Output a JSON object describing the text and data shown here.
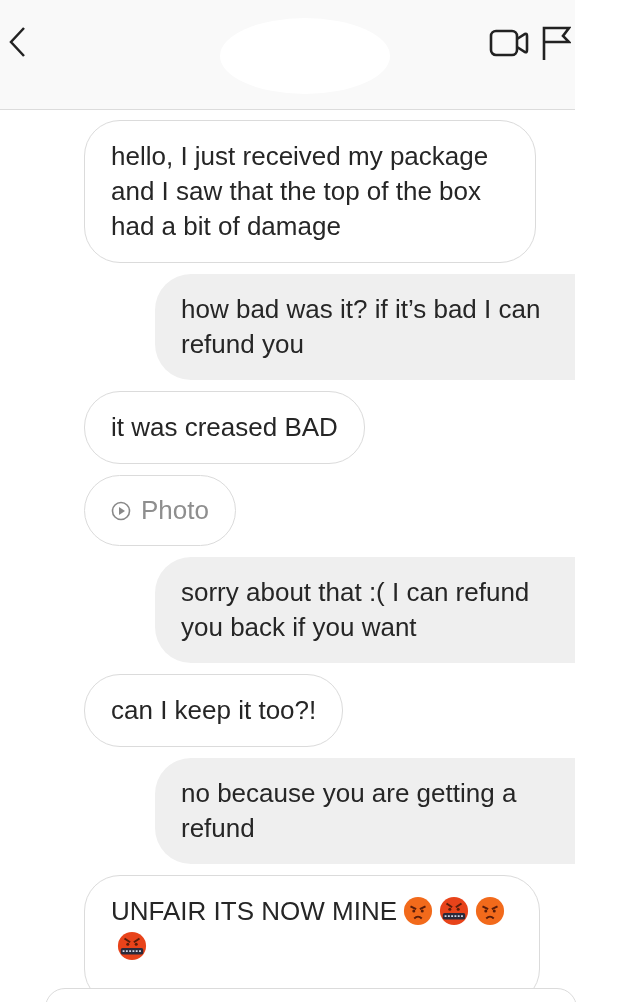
{
  "header": {
    "actions": [
      {
        "kind": "video"
      },
      {
        "kind": "flag"
      }
    ]
  },
  "messages": [
    {
      "kind": "received",
      "text": "hello, I just received my package and I saw that the top of the box had a bit of damage"
    },
    {
      "kind": "sent",
      "text": "how bad was it? if it’s bad I can refund you"
    },
    {
      "kind": "received",
      "text": "it was creased BAD"
    },
    {
      "kind": "received_photo",
      "text": "Photo"
    },
    {
      "kind": "sent",
      "text": "sorry about that :( I can refund you back if you want"
    },
    {
      "kind": "received",
      "text": "can I keep it too?!"
    },
    {
      "kind": "sent",
      "text": "no because you are getting a refund"
    },
    {
      "kind": "received",
      "text": "UNFAIR ITS NOW MINE",
      "emojis": [
        {
          "kind": "angry"
        },
        {
          "kind": "cursing"
        },
        {
          "kind": "angry"
        },
        {
          "kind": "cursing"
        }
      ]
    }
  ]
}
